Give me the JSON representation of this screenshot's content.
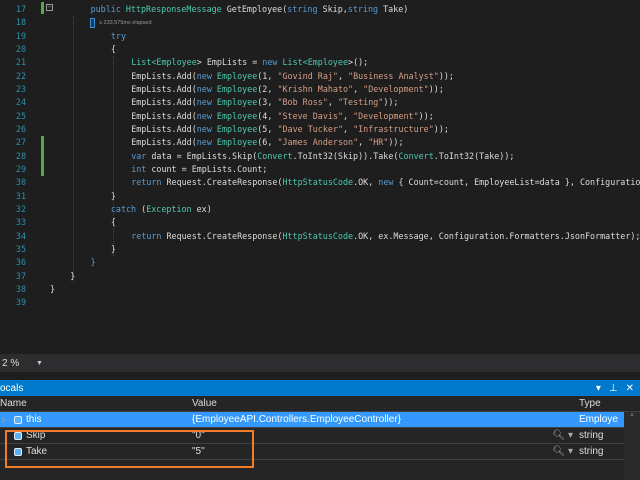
{
  "editor": {
    "perf_tip": "≤ 233,575ms elapsed",
    "lines": [
      {
        "n": "17",
        "indent": 2,
        "tokens": [
          [
            "public ",
            "k"
          ],
          [
            "HttpResponseMessage",
            "t"
          ],
          [
            " GetEmployee(",
            "p"
          ],
          [
            "string",
            "k"
          ],
          [
            " Skip,",
            "p"
          ],
          [
            "string",
            "k"
          ],
          [
            " Take)",
            "p"
          ]
        ]
      },
      {
        "n": "18",
        "indent": 2,
        "tokens": []
      },
      {
        "n": "19",
        "indent": 3,
        "tokens": [
          [
            "try",
            "k"
          ]
        ]
      },
      {
        "n": "20",
        "indent": 3,
        "tokens": [
          [
            "{",
            "p"
          ]
        ]
      },
      {
        "n": "21",
        "indent": 4,
        "tokens": [
          [
            "List<",
            "t"
          ],
          [
            "Employee",
            "t"
          ],
          [
            "> EmpLists = ",
            "p"
          ],
          [
            "new ",
            "k"
          ],
          [
            "List<",
            "t"
          ],
          [
            "Employee",
            "t"
          ],
          [
            ">();",
            "p"
          ]
        ]
      },
      {
        "n": "22",
        "indent": 4,
        "tokens": [
          [
            "EmpLists.Add(",
            "p"
          ],
          [
            "new ",
            "k"
          ],
          [
            "Employee",
            "t"
          ],
          [
            "(1, ",
            "p"
          ],
          [
            "\"Govind Raj\"",
            "s"
          ],
          [
            ", ",
            "p"
          ],
          [
            "\"Business Analyst\"",
            "s"
          ],
          [
            "));",
            "p"
          ]
        ]
      },
      {
        "n": "23",
        "indent": 4,
        "tokens": [
          [
            "EmpLists.Add(",
            "p"
          ],
          [
            "new ",
            "k"
          ],
          [
            "Employee",
            "t"
          ],
          [
            "(2, ",
            "p"
          ],
          [
            "\"Krishn Mahato\"",
            "s"
          ],
          [
            ", ",
            "p"
          ],
          [
            "\"Development\"",
            "s"
          ],
          [
            "));",
            "p"
          ]
        ]
      },
      {
        "n": "24",
        "indent": 4,
        "tokens": [
          [
            "EmpLists.Add(",
            "p"
          ],
          [
            "new ",
            "k"
          ],
          [
            "Employee",
            "t"
          ],
          [
            "(3, ",
            "p"
          ],
          [
            "\"Bob Ross\"",
            "s"
          ],
          [
            ", ",
            "p"
          ],
          [
            "\"Testing\"",
            "s"
          ],
          [
            "));",
            "p"
          ]
        ]
      },
      {
        "n": "25",
        "indent": 4,
        "tokens": [
          [
            "EmpLists.Add(",
            "p"
          ],
          [
            "new ",
            "k"
          ],
          [
            "Employee",
            "t"
          ],
          [
            "(4, ",
            "p"
          ],
          [
            "\"Steve Davis\"",
            "s"
          ],
          [
            ", ",
            "p"
          ],
          [
            "\"Development\"",
            "s"
          ],
          [
            "));",
            "p"
          ]
        ]
      },
      {
        "n": "26",
        "indent": 4,
        "tokens": [
          [
            "EmpLists.Add(",
            "p"
          ],
          [
            "new ",
            "k"
          ],
          [
            "Employee",
            "t"
          ],
          [
            "(5, ",
            "p"
          ],
          [
            "\"Dave Tucker\"",
            "s"
          ],
          [
            ", ",
            "p"
          ],
          [
            "\"Infrastructure\"",
            "s"
          ],
          [
            "));",
            "p"
          ]
        ]
      },
      {
        "n": "27",
        "indent": 4,
        "tokens": [
          [
            "EmpLists.Add(",
            "p"
          ],
          [
            "new ",
            "k"
          ],
          [
            "Employee",
            "t"
          ],
          [
            "(6, ",
            "p"
          ],
          [
            "\"James Anderson\"",
            "s"
          ],
          [
            ", ",
            "p"
          ],
          [
            "\"HR\"",
            "s"
          ],
          [
            "));",
            "p"
          ]
        ]
      },
      {
        "n": "28",
        "indent": 4,
        "tokens": [
          [
            "var ",
            "k"
          ],
          [
            "data = EmpLists.Skip(",
            "p"
          ],
          [
            "Convert",
            "t"
          ],
          [
            ".ToInt32(Skip)).Take(",
            "p"
          ],
          [
            "Convert",
            "t"
          ],
          [
            ".ToInt32(Take));",
            "p"
          ]
        ]
      },
      {
        "n": "29",
        "indent": 4,
        "tokens": [
          [
            "int ",
            "k"
          ],
          [
            "count = EmpLists.Count;",
            "p"
          ]
        ]
      },
      {
        "n": "30",
        "indent": 4,
        "tokens": [
          [
            "return ",
            "k"
          ],
          [
            "Request.CreateResponse(",
            "p"
          ],
          [
            "HttpStatusCode",
            "t"
          ],
          [
            ".OK, ",
            "p"
          ],
          [
            "new ",
            "k"
          ],
          [
            "{ Count=count, EmployeeList=data }, Configuration.",
            "p"
          ]
        ]
      },
      {
        "n": "31",
        "indent": 3,
        "tokens": [
          [
            "}",
            "p"
          ]
        ]
      },
      {
        "n": "32",
        "indent": 3,
        "tokens": [
          [
            "catch ",
            "k"
          ],
          [
            "(",
            "p"
          ],
          [
            "Exception",
            "t"
          ],
          [
            " ex)",
            "p"
          ]
        ]
      },
      {
        "n": "33",
        "indent": 3,
        "tokens": [
          [
            "{",
            "p"
          ]
        ]
      },
      {
        "n": "34",
        "indent": 4,
        "tokens": [
          [
            "return ",
            "k"
          ],
          [
            "Request.CreateResponse(",
            "p"
          ],
          [
            "HttpStatusCode",
            "t"
          ],
          [
            ".OK, ex.Message, Configuration.Formatters.JsonFormatter);",
            "p"
          ]
        ]
      },
      {
        "n": "35",
        "indent": 3,
        "tokens": [
          [
            "}",
            "p"
          ]
        ]
      },
      {
        "n": "36",
        "indent": 2,
        "tokens": [
          [
            "}",
            "k"
          ]
        ]
      },
      {
        "n": "37",
        "indent": 1,
        "tokens": [
          [
            "}",
            "p"
          ]
        ]
      },
      {
        "n": "38",
        "indent": 0,
        "tokens": [
          [
            "}",
            "p"
          ]
        ]
      },
      {
        "n": "39",
        "indent": 0,
        "tokens": []
      }
    ]
  },
  "zoom": {
    "value": "2 %"
  },
  "locals": {
    "title": "ocals",
    "columns": {
      "name": "Name",
      "value": "Value",
      "type": "Type"
    },
    "rows": [
      {
        "name": "this",
        "value": "{EmployeeAPI.Controllers.EmployeeController}",
        "type": "Employe",
        "selected": true
      },
      {
        "name": "Skip",
        "value": "\"0\"",
        "type": "string",
        "selected": false
      },
      {
        "name": "Take",
        "value": "\"5\"",
        "type": "string",
        "selected": false
      }
    ]
  },
  "colors": {
    "accent": "#007acc",
    "highlight": "#ef7d2a"
  }
}
